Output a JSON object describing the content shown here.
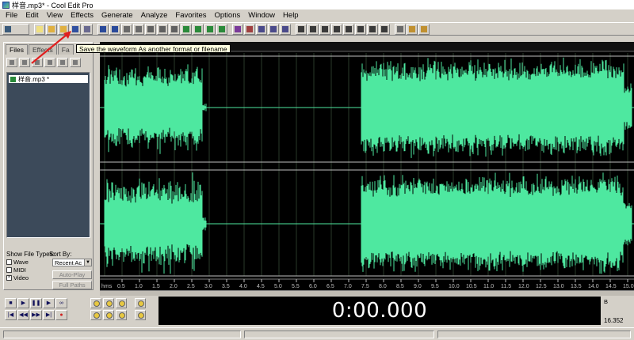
{
  "window": {
    "title": "样音.mp3* - Cool Edit Pro"
  },
  "menu": [
    "File",
    "Edit",
    "View",
    "Effects",
    "Generate",
    "Analyze",
    "Favorites",
    "Options",
    "Window",
    "Help"
  ],
  "tooltip": {
    "text": "Save the waveform As another format or filename"
  },
  "left_panel": {
    "tabs": [
      "Files",
      "Effects",
      "Fa"
    ],
    "files": [
      {
        "name": "样音.mp3 *"
      }
    ],
    "show_file_types_label": "Show File Types:",
    "file_types": [
      {
        "label": "Wave",
        "checked": false
      },
      {
        "label": "MIDI",
        "checked": false
      },
      {
        "label": "Video",
        "checked": true
      }
    ],
    "sort_by_label": "Sort By:",
    "sort_by_value": "Recent Ac",
    "autoplay_label": "Auto-Play",
    "fullpaths_label": "Full Paths"
  },
  "timeline": {
    "unit": "hms",
    "ticks": [
      "0.5",
      "1.0",
      "1.5",
      "2.0",
      "2.5",
      "3.0",
      "3.5",
      "4.0",
      "4.5",
      "5.0",
      "5.5",
      "6.0",
      "6.5",
      "7.0",
      "7.5",
      "8.0",
      "8.5",
      "9.0",
      "9.5",
      "10.0",
      "10.5",
      "11.0",
      "11.5",
      "12.0",
      "12.5",
      "13.0",
      "13.5",
      "14.0",
      "14.5",
      "15.0",
      "hms"
    ]
  },
  "waveform": {
    "color": "#4ee8a0",
    "background": "#000000",
    "grid_color": "#2a3a2a"
  },
  "time_display": {
    "value": "0:00.000"
  },
  "selection": {
    "begin_label": "B",
    "end_value": "16.352"
  }
}
